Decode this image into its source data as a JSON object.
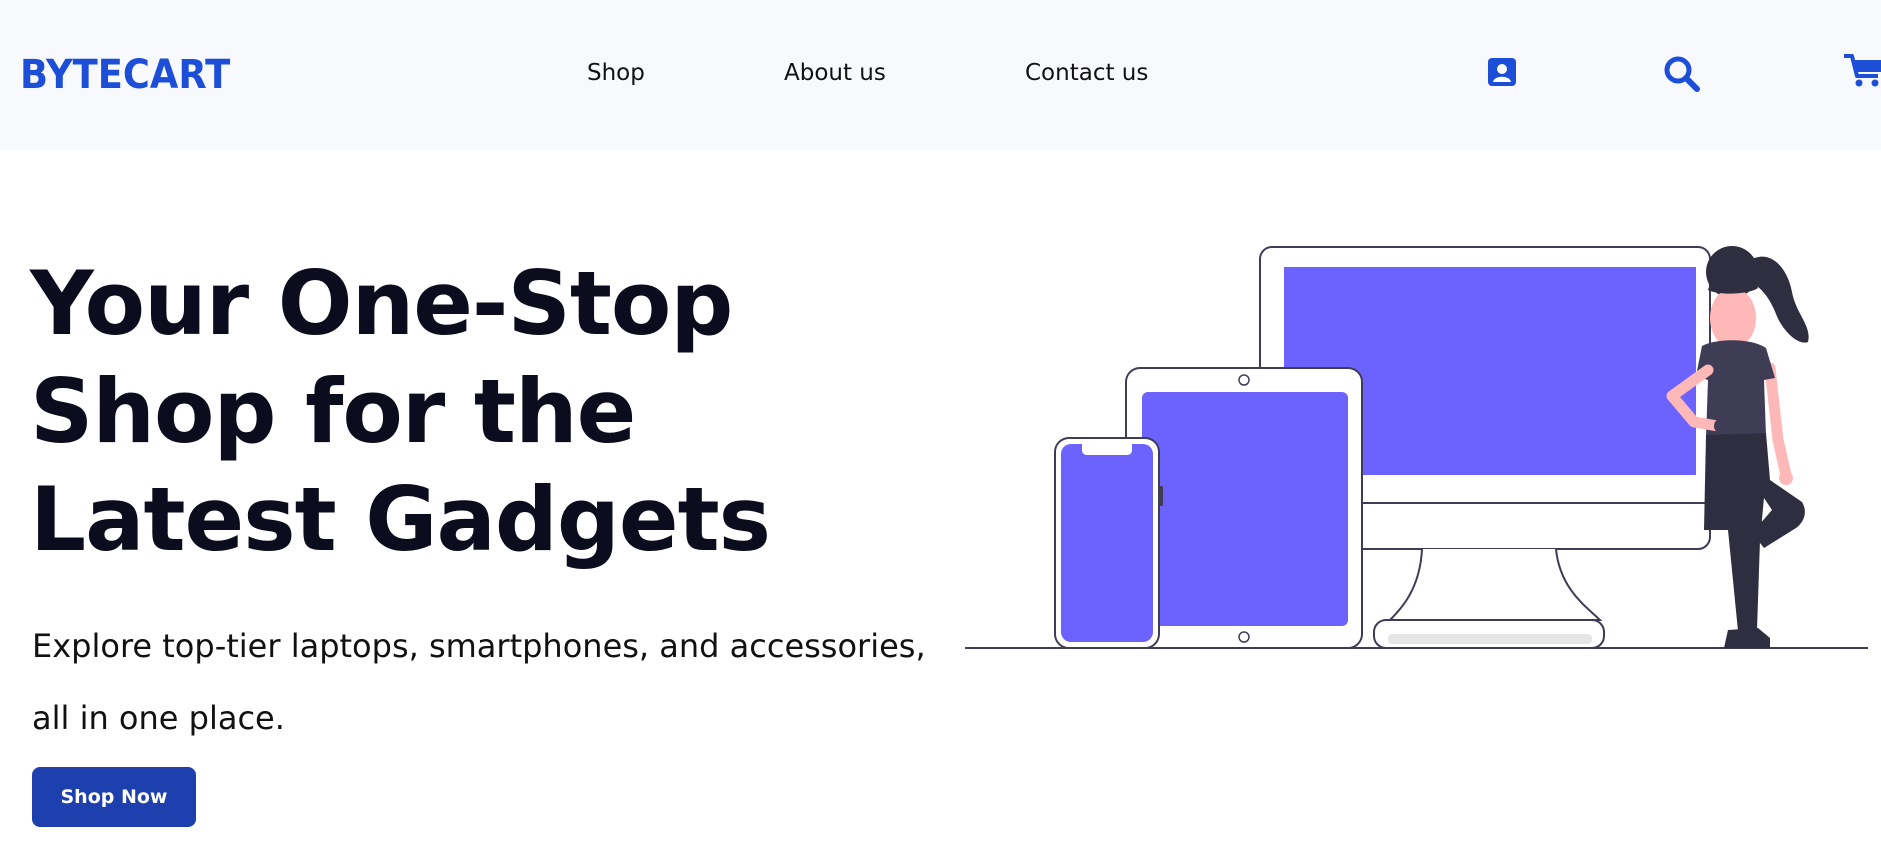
{
  "brand": {
    "name": "BYTECART",
    "color": "#1d4ed8"
  },
  "nav": {
    "links": [
      {
        "label": "Shop"
      },
      {
        "label": "About us"
      },
      {
        "label": "Contact us"
      }
    ],
    "icons": [
      "user-profile-icon",
      "search-icon",
      "cart-icon"
    ]
  },
  "hero": {
    "title": "Your One-Stop Shop for the Latest Gadgets",
    "subtitle": "Explore top-tier laptops, smartphones, and accessories, all in one place.",
    "cta_label": "Shop Now"
  },
  "colors": {
    "accent": "#1d4ed8",
    "button": "#1e40af",
    "screen": "#6c63ff",
    "navbar_bg": "#f7f9fc",
    "title": "#0b0c1e"
  }
}
